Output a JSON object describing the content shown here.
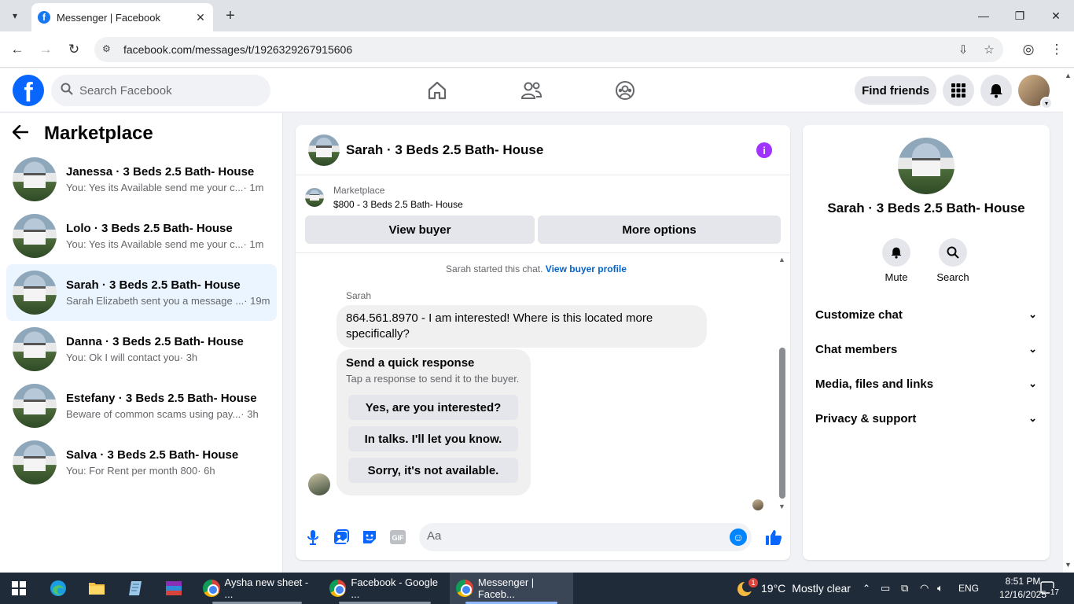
{
  "browser": {
    "tab_title": "Messenger | Facebook",
    "url": "facebook.com/messages/t/1926329267915606"
  },
  "header": {
    "search_placeholder": "Search Facebook",
    "find_friends": "Find friends"
  },
  "sidebar": {
    "title": "Marketplace",
    "conversations": [
      {
        "name": "Janessa · 3 Beds 2.5 Bath- House",
        "preview": "You: Yes its Available send me your c...",
        "time": "· 1m"
      },
      {
        "name": "Lolo · 3 Beds 2.5 Bath- House",
        "preview": "You: Yes its Available send me your c...",
        "time": "· 1m"
      },
      {
        "name": "Sarah · 3 Beds 2.5 Bath- House",
        "preview": "Sarah Elizabeth sent you a message ...",
        "time": "· 19m"
      },
      {
        "name": "Danna · 3 Beds 2.5 Bath- House",
        "preview": "You: Ok I will contact you",
        "time": "· 3h"
      },
      {
        "name": "Estefany · 3 Beds 2.5 Bath- House",
        "preview": "Beware of common scams using pay...",
        "time": "· 3h"
      },
      {
        "name": "Salva · 3 Beds 2.5 Bath- House",
        "preview": "You: For Rent per month 800",
        "time": "· 6h"
      }
    ]
  },
  "chat": {
    "title": "Sarah · 3 Beds 2.5 Bath- House",
    "marketplace_label": "Marketplace",
    "listing": "$800 - 3 Beds 2.5 Bath- House",
    "view_buyer": "View buyer",
    "more_options": "More options",
    "started_text": "Sarah started this chat.",
    "view_buyer_profile": "View buyer profile",
    "sender": "Sarah",
    "message": "864.561.8970 - I am interested! Where is this located more specifically?",
    "quick_title": "Send a quick response",
    "quick_sub": "Tap a response to send it to the buyer.",
    "quick_options": [
      "Yes, are you interested?",
      "In talks. I'll let you know.",
      "Sorry, it's not available."
    ],
    "composer_placeholder": "Aa",
    "gif_label": "GIF"
  },
  "info_panel": {
    "name": "Sarah · 3 Beds 2.5 Bath- House",
    "mute": "Mute",
    "search": "Search",
    "sections": [
      "Customize chat",
      "Chat members",
      "Media, files and links",
      "Privacy & support"
    ]
  },
  "taskbar": {
    "apps": [
      "Aysha new sheet - ...",
      "Facebook - Google ...",
      "Messenger | Faceb..."
    ],
    "weather": "19°C",
    "weather_text": "Mostly clear",
    "weather_badge": "1",
    "lang": "ENG",
    "time": "8:51 PM",
    "date": "12/16/2025",
    "notifications": "17"
  },
  "colors": {
    "fb_blue": "#0866ff",
    "active_row": "#ebf5ff",
    "info_purple": "#a033ff",
    "link": "#0064d1"
  }
}
